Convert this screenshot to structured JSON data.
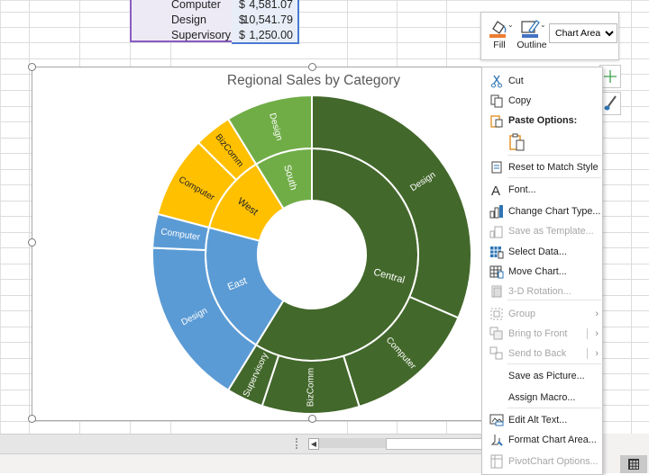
{
  "sheet": {
    "rows": [
      {
        "label": "Computer",
        "currency": "$",
        "value": "4,581.07"
      },
      {
        "label": "Design",
        "currency": "$",
        "value": "10,541.79"
      },
      {
        "label": "Supervisory",
        "currency": "$",
        "value": "1,250.00"
      }
    ]
  },
  "format_toolbar": {
    "fill_label": "Fill",
    "outline_label": "Outline",
    "element_select": "Chart Area",
    "fill_color": "#ed7d31",
    "outline_color": "#4472c4"
  },
  "context_menu": {
    "items": [
      {
        "label": "Cut",
        "icon": "scissors-icon",
        "enabled": true
      },
      {
        "label": "Copy",
        "icon": "copy-icon",
        "enabled": true
      },
      {
        "label": "Paste Options:",
        "icon": "paste-icon",
        "enabled": true,
        "header": true
      },
      {
        "label": "Reset to Match Style",
        "icon": "reset-style-icon",
        "enabled": true
      },
      {
        "label": "Font...",
        "icon": "font-icon",
        "enabled": true
      },
      {
        "label": "Change Chart Type...",
        "icon": "chart-type-icon",
        "enabled": true
      },
      {
        "label": "Save as Template...",
        "icon": "template-icon",
        "enabled": false
      },
      {
        "label": "Select Data...",
        "icon": "select-data-icon",
        "enabled": true
      },
      {
        "label": "Move Chart...",
        "icon": "move-chart-icon",
        "enabled": true
      },
      {
        "label": "3-D Rotation...",
        "icon": "rotation-icon",
        "enabled": false
      },
      {
        "label": "Group",
        "icon": "group-icon",
        "enabled": false,
        "submenu": true
      },
      {
        "label": "Bring to Front",
        "icon": "bring-front-icon",
        "enabled": false,
        "submenu": true
      },
      {
        "label": "Send to Back",
        "icon": "send-back-icon",
        "enabled": false,
        "submenu": true
      },
      {
        "label": "Save as Picture...",
        "icon": "",
        "enabled": true
      },
      {
        "label": "Assign Macro...",
        "icon": "",
        "enabled": true
      },
      {
        "label": "Edit Alt Text...",
        "icon": "alt-text-icon",
        "enabled": true
      },
      {
        "label": "Format Chart Area...",
        "icon": "format-icon",
        "enabled": true
      },
      {
        "label": "PivotChart Options...",
        "icon": "pivot-icon",
        "enabled": false
      }
    ]
  },
  "chart_data": {
    "type": "sunburst",
    "title": "Regional Sales by Category",
    "colors": {
      "Central": "#43682b",
      "East": "#5b9bd5",
      "West": "#ffc000",
      "South": "#70ad47"
    },
    "label_colors": {
      "Central": "#ffffff",
      "East": "#ffffff",
      "West": "#262626",
      "South": "#ffffff"
    },
    "series": [
      {
        "name": "Central",
        "children": [
          {
            "name": "Design",
            "value": 10541.79
          },
          {
            "name": "Computer",
            "value": 4581.07
          },
          {
            "name": "BizComm",
            "value": 3300
          },
          {
            "name": "Supervisory",
            "value": 1250.0
          }
        ]
      },
      {
        "name": "East",
        "children": [
          {
            "name": "Design",
            "value": 5650
          },
          {
            "name": "Computer",
            "value": 1150
          }
        ]
      },
      {
        "name": "West",
        "children": [
          {
            "name": "Computer",
            "value": 2780
          },
          {
            "name": "BizComm",
            "value": 1270
          }
        ]
      },
      {
        "name": "South",
        "children": [
          {
            "name": "Design",
            "value": 2940
          }
        ]
      }
    ]
  }
}
